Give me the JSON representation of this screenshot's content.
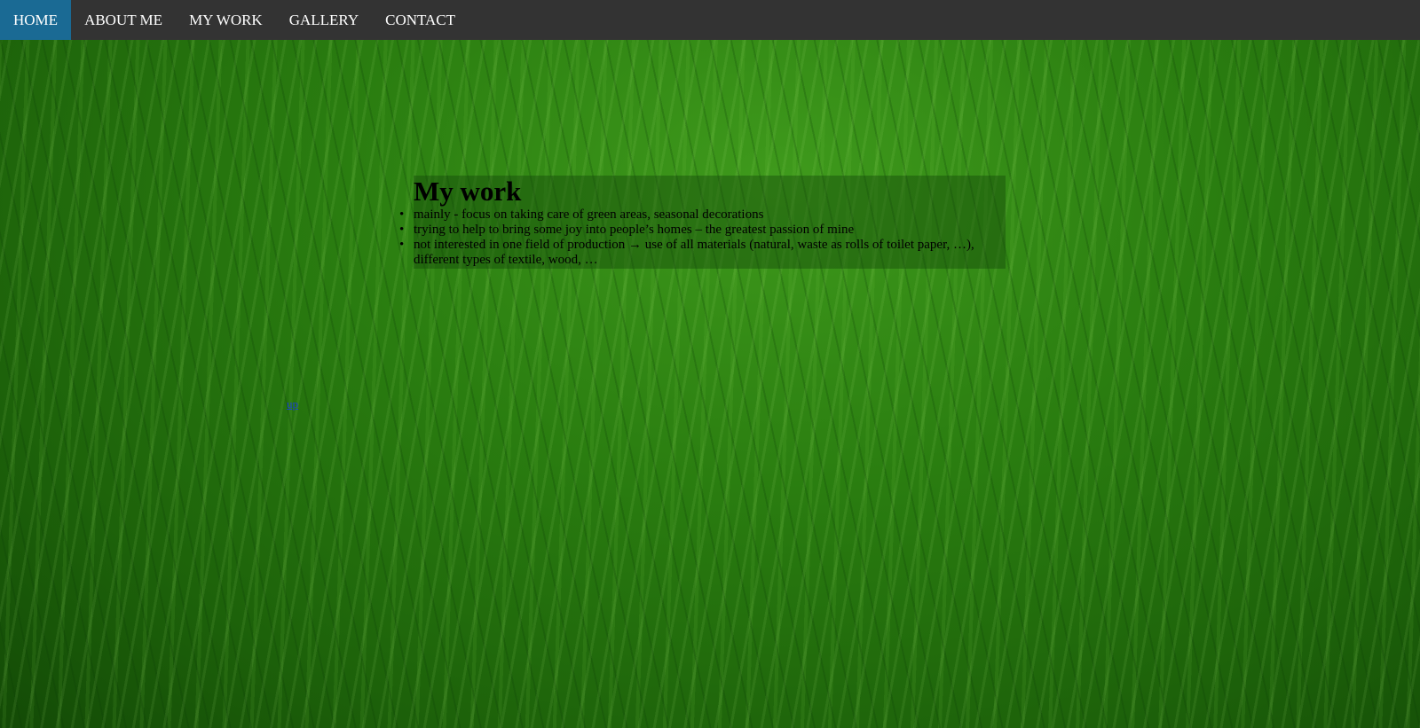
{
  "nav": {
    "items": [
      {
        "label": "HOME",
        "active": true
      },
      {
        "label": "ABOUT ME",
        "active": false
      },
      {
        "label": "MY WORK",
        "active": false
      },
      {
        "label": "GALLERY",
        "active": false
      },
      {
        "label": "CONTACT",
        "active": false
      }
    ],
    "background": "#333333",
    "active_background": "#1a6a94"
  },
  "main": {
    "title": "My work",
    "items": [
      "mainly - focus on taking care of green areas, seasonal decorations",
      "trying to help to bring some joy into people’s homes – the greatest passion of mine",
      "not interested in one field of production → use of all materials (natural, waste as rolls of toilet paper, …), different types of textile, wood, …"
    ]
  },
  "top_link": {
    "label": "up"
  },
  "background": {
    "description_icon": "grass-background",
    "color": "#2a7d10"
  }
}
